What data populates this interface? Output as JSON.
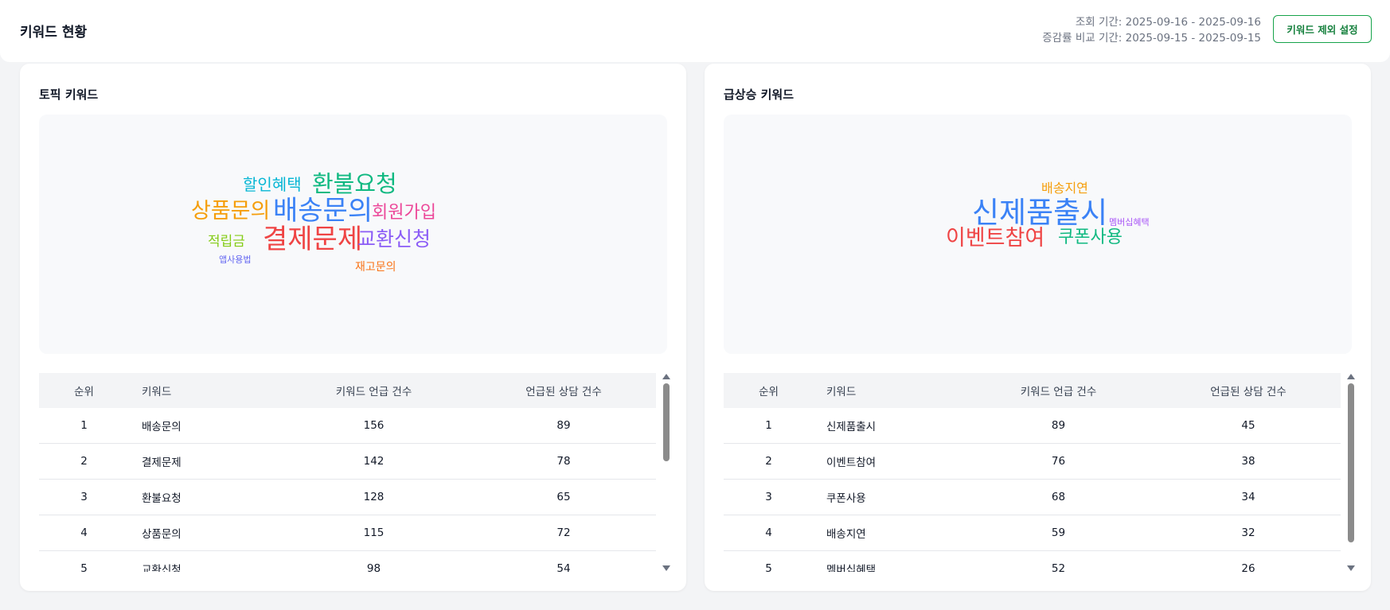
{
  "header": {
    "title": "키워드 현황",
    "view_period": "조회 기간: 2025-09-16 - 2025-09-16",
    "compare_period": "증감률 비교 기간: 2025-09-15 - 2025-09-15",
    "exclude_button": "키워드 제외 설정"
  },
  "topic": {
    "title": "토픽 키워드",
    "cloud": [
      {
        "text": "할인혜택",
        "color": "#06b6d4"
      },
      {
        "text": "환불요청",
        "color": "#10b981"
      },
      {
        "text": "상품문의",
        "color": "#f59e0b"
      },
      {
        "text": "배송문의",
        "color": "#3b82f6"
      },
      {
        "text": "회원가입",
        "color": "#ec4899"
      },
      {
        "text": "적립금",
        "color": "#84cc16"
      },
      {
        "text": "결제문제",
        "color": "#ef4444"
      },
      {
        "text": "교환신청",
        "color": "#8b5cf6"
      },
      {
        "text": "앱사용법",
        "color": "#6366f1"
      },
      {
        "text": "재고문의",
        "color": "#f97316"
      }
    ],
    "columns": [
      "순위",
      "키워드",
      "키워드 언급 건수",
      "언급된 상담 건수"
    ],
    "rows": [
      {
        "rank": "1",
        "keyword": "배송문의",
        "mentions": "156",
        "consultations": "89"
      },
      {
        "rank": "2",
        "keyword": "결제문제",
        "mentions": "142",
        "consultations": "78"
      },
      {
        "rank": "3",
        "keyword": "환불요청",
        "mentions": "128",
        "consultations": "65"
      },
      {
        "rank": "4",
        "keyword": "상품문의",
        "mentions": "115",
        "consultations": "72"
      },
      {
        "rank": "5",
        "keyword": "교환신청",
        "mentions": "98",
        "consultations": "54"
      }
    ]
  },
  "rising": {
    "title": "급상승 키워드",
    "cloud": [
      {
        "text": "배송지연",
        "color": "#f59e0b"
      },
      {
        "text": "신제품출시",
        "color": "#3b82f6"
      },
      {
        "text": "멤버십혜택",
        "color": "#a855f7"
      },
      {
        "text": "이벤트참여",
        "color": "#ef4444"
      },
      {
        "text": "쿠폰사용",
        "color": "#10b981"
      }
    ],
    "columns": [
      "순위",
      "키워드",
      "키워드 언급 건수",
      "언급된 상담 건수"
    ],
    "rows": [
      {
        "rank": "1",
        "keyword": "신제품출시",
        "mentions": "89",
        "consultations": "45"
      },
      {
        "rank": "2",
        "keyword": "이벤트참여",
        "mentions": "76",
        "consultations": "38"
      },
      {
        "rank": "3",
        "keyword": "쿠폰사용",
        "mentions": "68",
        "consultations": "34"
      },
      {
        "rank": "4",
        "keyword": "배송지연",
        "mentions": "59",
        "consultations": "32"
      },
      {
        "rank": "5",
        "keyword": "멤버십혜택",
        "mentions": "52",
        "consultations": "26"
      }
    ]
  }
}
